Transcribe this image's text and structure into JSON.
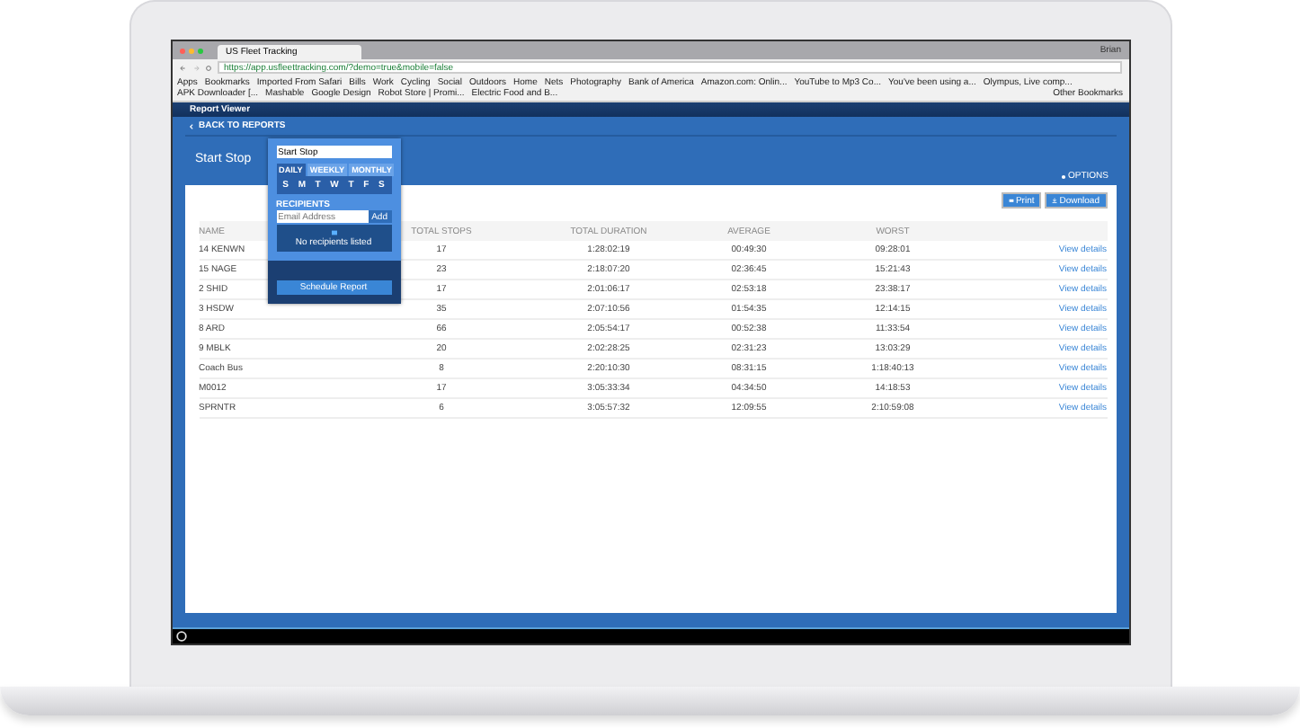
{
  "browser": {
    "tab": {
      "title": "US Fleet Tracking"
    },
    "url": "https://app.usfleettracking.com/?demo=true&mobile=false",
    "user": "Brian",
    "bookmarks": [
      "Apps",
      "Bookmarks",
      "Imported From Safari",
      "Bills",
      "Work",
      "Cycling",
      "Social",
      "Outdoors",
      "Home",
      "Nets",
      "Photography",
      "Bank of America",
      "Amazon.com: Onlin...",
      "YouTube to Mp3 Co...",
      "You've been using a...",
      "Olympus, Live comp...",
      "APK Downloader [...",
      "Mashable",
      "Google Design",
      "Robot Store | Promi...",
      "Electric Food and B..."
    ],
    "other_bookmarks": "Other Bookmarks"
  },
  "app": {
    "title": "Report Viewer",
    "back_link": "BACK TO REPORTS",
    "page_title": "Start Stop",
    "options": "OPTIONS",
    "buttons": [
      {
        "label": "Print",
        "kind": "print"
      },
      {
        "label": "Download",
        "kind": "download"
      }
    ]
  },
  "table": {
    "columns": [
      "NAME",
      "TOTAL STOPS",
      "TOTAL DURATION",
      "AVERAGE",
      "WORST"
    ],
    "rows": [
      {
        "name": "14 KENWN",
        "total_stops": "17",
        "total_duration": "1:28:02:19",
        "average": "00:49:30",
        "worst": "09:28:01",
        "action": "View details"
      },
      {
        "name": "15 NAGE",
        "total_stops": "23",
        "total_duration": "2:18:07:20",
        "average": "02:36:45",
        "worst": "15:21:43",
        "action": "View details"
      },
      {
        "name": "2 SHID",
        "total_stops": "17",
        "total_duration": "2:01:06:17",
        "average": "02:53:18",
        "worst": "23:38:17",
        "action": "View details"
      },
      {
        "name": "3 HSDW",
        "total_stops": "35",
        "total_duration": "2:07:10:56",
        "average": "01:54:35",
        "worst": "12:14:15",
        "action": "View details"
      },
      {
        "name": "8 ARD",
        "total_stops": "66",
        "total_duration": "2:05:54:17",
        "average": "00:52:38",
        "worst": "11:33:54",
        "action": "View details"
      },
      {
        "name": "9 MBLK",
        "total_stops": "20",
        "total_duration": "2:02:28:25",
        "average": "02:31:23",
        "worst": "13:03:29",
        "action": "View details"
      },
      {
        "name": "Coach Bus",
        "total_stops": "8",
        "total_duration": "2:20:10:30",
        "average": "08:31:15",
        "worst": "1:18:40:13",
        "action": "View details"
      },
      {
        "name": "M0012",
        "total_stops": "17",
        "total_duration": "3:05:33:34",
        "average": "04:34:50",
        "worst": "14:18:53",
        "action": "View details"
      },
      {
        "name": "SPRNTR",
        "total_stops": "6",
        "total_duration": "3:05:57:32",
        "average": "12:09:55",
        "worst": "2:10:59:08",
        "action": "View details"
      }
    ]
  },
  "schedule_popup": {
    "name_value": "Start Stop",
    "tabs": [
      {
        "label": "DAILY",
        "selected": true
      },
      {
        "label": "WEEKLY",
        "selected": false
      },
      {
        "label": "MONTHLY",
        "selected": false
      }
    ],
    "days": [
      {
        "label": "S",
        "selected": true
      },
      {
        "label": "M",
        "selected": true
      },
      {
        "label": "T",
        "selected": true
      },
      {
        "label": "W",
        "selected": true
      },
      {
        "label": "T",
        "selected": true
      },
      {
        "label": "F",
        "selected": true
      },
      {
        "label": "S",
        "selected": true
      }
    ],
    "recipients_label": "RECIPIENTS",
    "email_placeholder": "Email Address",
    "add_button": "Add",
    "empty_message": "No recipients listed",
    "schedule_button": "Schedule Report"
  }
}
